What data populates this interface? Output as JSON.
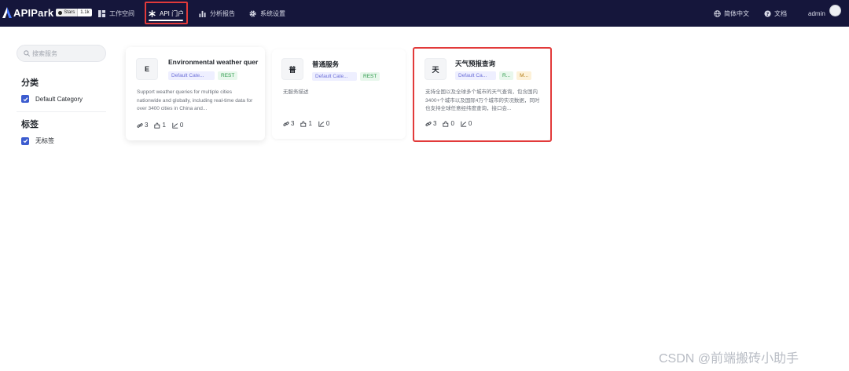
{
  "app": {
    "name": "APIPark",
    "github_star_label": "Stars",
    "github_star_count": "1.1k"
  },
  "nav": {
    "items": [
      {
        "label": "工作空间",
        "icon": "workspace-icon"
      },
      {
        "label": "API 门户",
        "icon": "portal-icon",
        "active": true
      },
      {
        "label": "分析报告",
        "icon": "chart-icon"
      },
      {
        "label": "系统设置",
        "icon": "gear-icon"
      }
    ],
    "language": "简体中文",
    "docs": "文档",
    "user": "admin"
  },
  "sidebar": {
    "search_placeholder": "搜索服务",
    "category_title": "分类",
    "categories": [
      {
        "label": "Default Category",
        "checked": true
      }
    ],
    "tag_title": "标签",
    "tags": [
      {
        "label": "无标签",
        "checked": true
      }
    ]
  },
  "cards": [
    {
      "icon_letter": "E",
      "title": "Environmental weather quer",
      "tags": [
        {
          "label": "Default Cate...",
          "kind": "cat"
        },
        {
          "label": "REST",
          "kind": "rest"
        }
      ],
      "description": "Support weather queries for multiple cities nationwide and globally, including real-time data for over 3400 cities in China and...",
      "stats": {
        "apis": "3",
        "subscribers": "1",
        "calls": "0"
      }
    },
    {
      "icon_letter": "普",
      "title": "普通服务",
      "tags": [
        {
          "label": "Default Cate...",
          "kind": "cat"
        },
        {
          "label": "REST",
          "kind": "rest"
        }
      ],
      "description": "无服务描述",
      "stats": {
        "apis": "3",
        "subscribers": "1",
        "calls": "0"
      }
    },
    {
      "icon_letter": "天",
      "title": "天气预报查询",
      "tags": [
        {
          "label": "Default Ca...",
          "kind": "cat"
        },
        {
          "label": "R...",
          "kind": "rest"
        },
        {
          "label": "M...",
          "kind": "m"
        }
      ],
      "description": "支持全国以及全球多个城市的天气查询，包含国内3400+个城市以及国际4万个城市的实况数据，同时也支持全球任意经纬度查询，接口会...",
      "stats": {
        "apis": "3",
        "subscribers": "0",
        "calls": "0"
      }
    }
  ],
  "watermark": "CSDN @前端搬砖小助手",
  "colors": {
    "topbar": "#15163b",
    "accent": "#3c5ccf",
    "highlight": "#e23a3a"
  }
}
